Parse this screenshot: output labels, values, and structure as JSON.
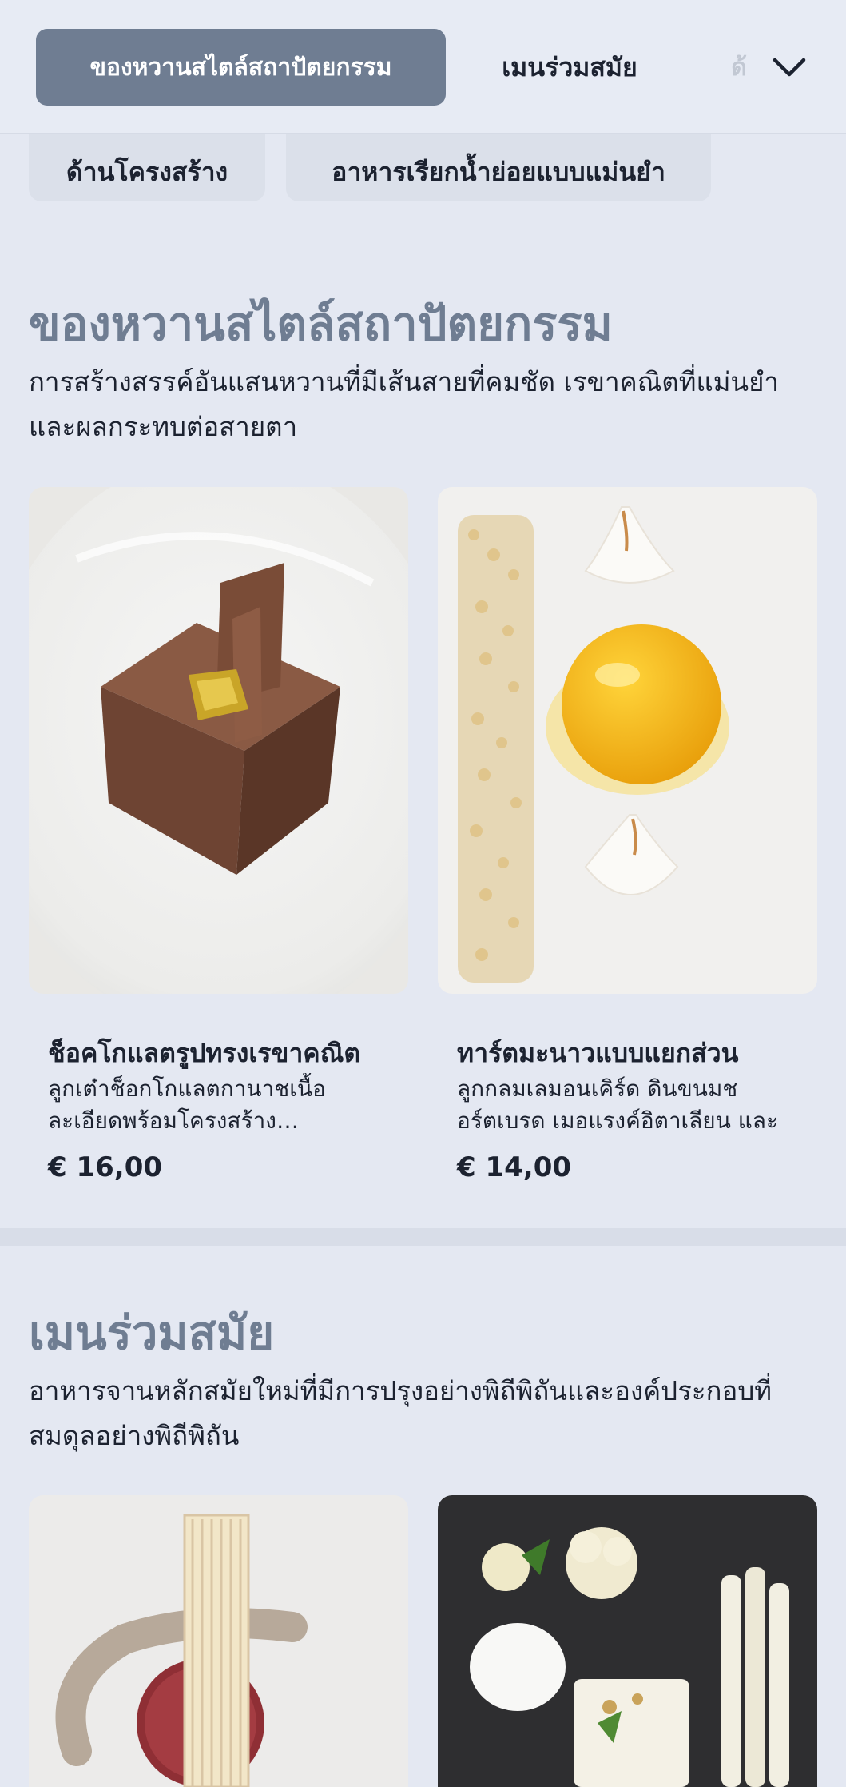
{
  "nav": {
    "active_tab": "ของหวานสไตล์สถาปัตยกรรม",
    "tab_2": "เมนร่วมสมัย",
    "tab_3_partial": "ด้"
  },
  "chips": [
    {
      "label": "ด้านโครงสร้าง"
    },
    {
      "label": "อาหารเรียกน้ำย่อยแบบแม่นยำ"
    }
  ],
  "sections": [
    {
      "title": "ของหวานสไตล์สถาปัตยกรรม",
      "description": "การสร้างสรรค์อันแสนหวานที่มีเส้นสายที่คมชัด เรขาคณิตที่แม่นยำ และผลกระทบต่อสายตา",
      "items": [
        {
          "name": "ช็อคโกแลตรูปทรงเรขาคณิต",
          "description": "ลูกเต๋าช็อกโกแลตกานาชเนื้อละเอียดพร้อมโครงสร้างช็อกโกแลตทองคำเปลว",
          "price": "€ 16,00"
        },
        {
          "name": "ทาร์ตมะนาวแบบแยกส่วน",
          "description": "ลูกกลมเลมอนเคิร์ด ดินขนมชอร์ตเบรด เมอแรงค์อิตาเลียน และ",
          "price": "€ 14,00"
        }
      ]
    },
    {
      "title": "เมนร่วมสมัย",
      "description": "อาหารจานหลักสมัยใหม่ที่มีการปรุงอย่างพิถีพิถันและองค์ประกอบที่สมดุลอย่างพิถีพิถัน",
      "items": []
    }
  ],
  "icons": {
    "nav_expand": "chevron-down-icon"
  },
  "colors": {
    "accent": "#6f7d92",
    "background": "#e4e8f2",
    "chip": "#dbe0ea"
  }
}
